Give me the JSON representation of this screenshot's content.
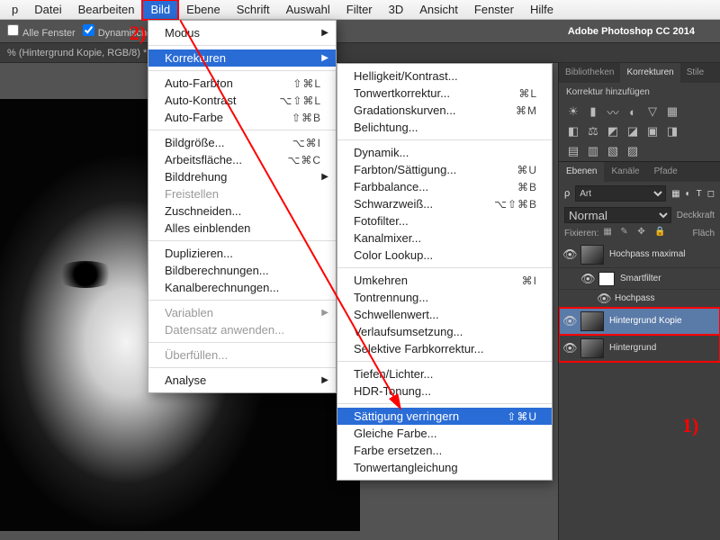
{
  "app_title": "Adobe Photoshop CC 2014",
  "annotation": {
    "step1": "1)",
    "step2": "2)"
  },
  "menubar": {
    "app": "p",
    "items": [
      "Datei",
      "Bearbeiten",
      "Bild",
      "Ebene",
      "Schrift",
      "Auswahl",
      "Filter",
      "3D",
      "Ansicht",
      "Fenster",
      "Hilfe"
    ],
    "highlighted": "Bild"
  },
  "toolbar": {
    "alle_fenster": "Alle Fenster",
    "dynamischer": "Dynamischer"
  },
  "tab": "% (Hintergrund Kopie, RGB/8) *",
  "menu_bild": {
    "items": [
      {
        "t": "Modus",
        "arr": true
      },
      {
        "sep": true
      },
      {
        "t": "Korrekturen",
        "arr": true,
        "hl": true
      },
      {
        "sep": true
      },
      {
        "t": "Auto-Farbton",
        "sc": "⇧⌘L"
      },
      {
        "t": "Auto-Kontrast",
        "sc": "⌥⇧⌘L"
      },
      {
        "t": "Auto-Farbe",
        "sc": "⇧⌘B"
      },
      {
        "sep": true
      },
      {
        "t": "Bildgröße...",
        "sc": "⌥⌘I"
      },
      {
        "t": "Arbeitsfläche...",
        "sc": "⌥⌘C"
      },
      {
        "t": "Bilddrehung",
        "arr": true
      },
      {
        "t": "Freistellen",
        "dis": true
      },
      {
        "t": "Zuschneiden..."
      },
      {
        "t": "Alles einblenden"
      },
      {
        "sep": true
      },
      {
        "t": "Duplizieren..."
      },
      {
        "t": "Bildberechnungen..."
      },
      {
        "t": "Kanalberechnungen..."
      },
      {
        "sep": true
      },
      {
        "t": "Variablen",
        "arr": true,
        "dis": true
      },
      {
        "t": "Datensatz anwenden...",
        "dis": true
      },
      {
        "sep": true
      },
      {
        "t": "Überfüllen...",
        "dis": true
      },
      {
        "sep": true
      },
      {
        "t": "Analyse",
        "arr": true
      }
    ]
  },
  "menu_korr": {
    "items": [
      {
        "t": "Helligkeit/Kontrast..."
      },
      {
        "t": "Tonwertkorrektur...",
        "sc": "⌘L"
      },
      {
        "t": "Gradationskurven...",
        "sc": "⌘M"
      },
      {
        "t": "Belichtung..."
      },
      {
        "sep": true
      },
      {
        "t": "Dynamik..."
      },
      {
        "t": "Farbton/Sättigung...",
        "sc": "⌘U"
      },
      {
        "t": "Farbbalance...",
        "sc": "⌘B"
      },
      {
        "t": "Schwarzweiß...",
        "sc": "⌥⇧⌘B"
      },
      {
        "t": "Fotofilter..."
      },
      {
        "t": "Kanalmixer..."
      },
      {
        "t": "Color Lookup..."
      },
      {
        "sep": true
      },
      {
        "t": "Umkehren",
        "sc": "⌘I"
      },
      {
        "t": "Tontrennung..."
      },
      {
        "t": "Schwellenwert..."
      },
      {
        "t": "Verlaufsumsetzung..."
      },
      {
        "t": "Selektive Farbkorrektur..."
      },
      {
        "sep": true
      },
      {
        "t": "Tiefen/Lichter..."
      },
      {
        "t": "HDR-Tonung..."
      },
      {
        "sep": true
      },
      {
        "t": "Sättigung verringern",
        "sc": "⇧⌘U",
        "hl": true
      },
      {
        "t": "Gleiche Farbe..."
      },
      {
        "t": "Farbe ersetzen..."
      },
      {
        "t": "Tonwertangleichung"
      }
    ]
  },
  "panels": {
    "tabs1": [
      "Bibliotheken",
      "Korrekturen",
      "Stile"
    ],
    "tabs1_active": "Korrekturen",
    "adj_header": "Korrektur hinzufügen",
    "layer_tabs": [
      "Ebenen",
      "Kanäle",
      "Pfade"
    ],
    "layer_tabs_active": "Ebenen",
    "filter_label": "Art",
    "blend_mode": "Normal",
    "opacity_label": "Deckkraft",
    "fix_label": "Fixieren:",
    "fill_label": "Fläch",
    "layers": [
      {
        "name": "Hochpass maximal",
        "eye": true,
        "kind": "smart"
      },
      {
        "name": "Smartfilter",
        "sub": true,
        "eye": true,
        "white": true
      },
      {
        "name": "Hochpass",
        "sub2": true,
        "eye": true
      },
      {
        "name": "Hintergrund Kopie",
        "eye": true,
        "sel": true,
        "red": true
      },
      {
        "name": "Hintergrund",
        "eye": true,
        "red": true
      }
    ]
  }
}
